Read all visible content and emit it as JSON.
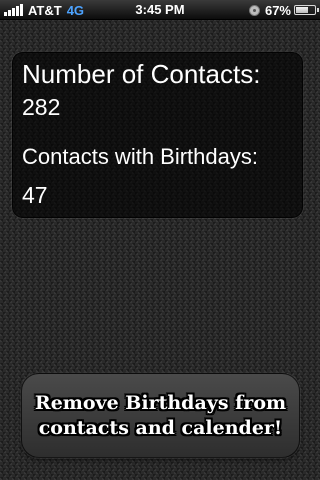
{
  "status_bar": {
    "carrier": "AT&T",
    "network": "4G",
    "time": "3:45 PM",
    "battery_percent": "67%",
    "battery_level": 0.67,
    "icons": [
      "signal-icon",
      "rotation-lock-icon",
      "battery-icon"
    ]
  },
  "info": {
    "contacts_label": "Number of Contacts:",
    "contacts_value": "282",
    "birthdays_label": "Contacts with Birthdays:",
    "birthdays_value": "47"
  },
  "action": {
    "line1": "Remove Birthdays from",
    "line2": "contacts and calender!"
  },
  "colors": {
    "network_accent": "#4da3ff",
    "text": "#ffffff"
  }
}
